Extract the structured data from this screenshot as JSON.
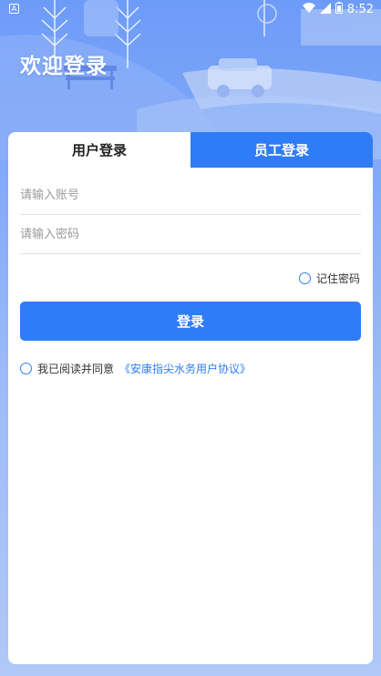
{
  "status_bar": {
    "notification_glyph": "A",
    "time": "8:52",
    "icons": [
      "wifi-icon",
      "cellular-icon",
      "battery-icon"
    ]
  },
  "header": {
    "title": "欢迎登录"
  },
  "tabs": [
    {
      "label": "用户登录",
      "active": true
    },
    {
      "label": "员工登录",
      "active": false
    }
  ],
  "form": {
    "account": {
      "placeholder": "请输入账号",
      "value": ""
    },
    "password": {
      "placeholder": "请输入密码",
      "value": ""
    },
    "remember_label": "记住密码",
    "remember_checked": false,
    "submit_label": "登录",
    "agreement_prefix": "我已阅读并同意",
    "agreement_link": "《安康指尖水务用户协议》",
    "agreement_checked": false
  },
  "colors": {
    "accent": "#2f7cf6",
    "background": "#7fa7f7"
  }
}
